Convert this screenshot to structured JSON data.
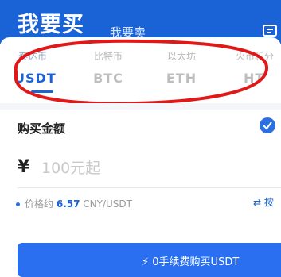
{
  "header": {
    "title": "我要买",
    "sell_tab": "我要卖"
  },
  "tabs": [
    {
      "cn": "泰达币",
      "en": "USDT"
    },
    {
      "cn": "比特币",
      "en": "BTC"
    },
    {
      "cn": "以太坊",
      "en": "ETH"
    },
    {
      "cn": "火币积分",
      "en": "HT"
    }
  ],
  "form": {
    "amount_label": "购买金额",
    "currency_symbol": "¥",
    "amount_placeholder": "100元起",
    "price_prefix": "价格约",
    "price_value": "6.57",
    "price_unit": "CNY/USDT",
    "switch_label": "按"
  },
  "action": {
    "buy_button": "0手续费购买USDT"
  },
  "colors": {
    "brand": "#1a63d6",
    "annotation": "#e01818"
  }
}
